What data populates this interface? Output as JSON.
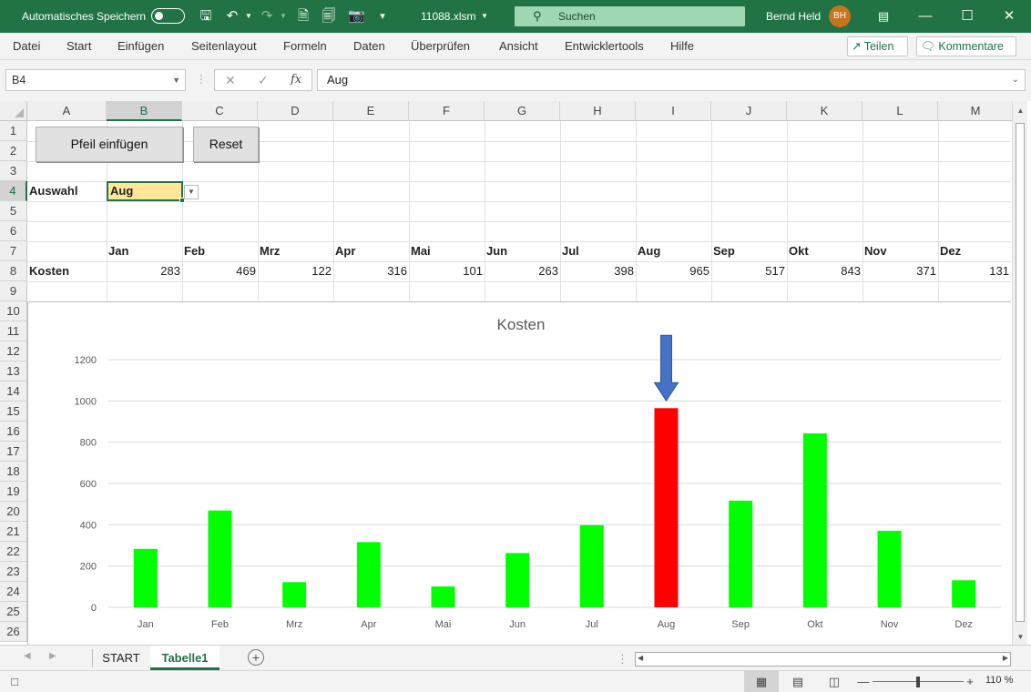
{
  "titlebar": {
    "autosave_label": "Automatisches Speichern",
    "filename": "11088.xlsm",
    "search_placeholder": "Suchen",
    "user_name": "Bernd Held",
    "user_initials": "BH"
  },
  "menu": {
    "items": [
      "Datei",
      "Start",
      "Einfügen",
      "Seitenlayout",
      "Formeln",
      "Daten",
      "Überprüfen",
      "Ansicht",
      "Entwicklertools",
      "Hilfe"
    ],
    "share_label": "Teilen",
    "comments_label": "Kommentare"
  },
  "formula_bar": {
    "name_box": "B4",
    "value": "Aug",
    "fx_label": "fx"
  },
  "columns": [
    "A",
    "B",
    "C",
    "D",
    "E",
    "F",
    "G",
    "H",
    "I",
    "J",
    "K",
    "L",
    "M"
  ],
  "selected_column": "B",
  "rows": [
    "1",
    "2",
    "3",
    "4",
    "5",
    "6",
    "7",
    "8",
    "9",
    "10",
    "11",
    "12",
    "13",
    "14",
    "15",
    "16",
    "17",
    "18",
    "19",
    "20",
    "21",
    "22",
    "23",
    "24",
    "25",
    "26"
  ],
  "selected_row": "4",
  "sheet": {
    "button_insert": "Pfeil einfügen",
    "button_reset": "Reset",
    "label_auswahl": "Auswahl",
    "selected_month": "Aug",
    "label_kosten": "Kosten",
    "months": [
      "Jan",
      "Feb",
      "Mrz",
      "Apr",
      "Mai",
      "Jun",
      "Jul",
      "Aug",
      "Sep",
      "Okt",
      "Nov",
      "Dez"
    ],
    "values": [
      "283",
      "469",
      "122",
      "316",
      "101",
      "263",
      "398",
      "965",
      "517",
      "843",
      "371",
      "131"
    ]
  },
  "chart_data": {
    "type": "bar",
    "title": "Kosten",
    "categories": [
      "Jan",
      "Feb",
      "Mrz",
      "Apr",
      "Mai",
      "Jun",
      "Jul",
      "Aug",
      "Sep",
      "Okt",
      "Nov",
      "Dez"
    ],
    "series": [
      {
        "values": [
          283,
          469,
          122,
          316,
          101,
          263,
          398,
          965,
          517,
          843,
          371,
          131
        ]
      }
    ],
    "highlight_category": "Aug",
    "bar_color": "#00ff00",
    "highlight_color": "#ff0000",
    "arrow_color": "#4472c4",
    "ylim": [
      0,
      1200
    ],
    "yticks": [
      0,
      200,
      400,
      600,
      800,
      1000,
      1200
    ],
    "grid": true,
    "xlabel": "",
    "ylabel": ""
  },
  "tabs": {
    "items": [
      "START",
      "Tabelle1"
    ],
    "active": "Tabelle1"
  },
  "status": {
    "zoom": "110 %"
  },
  "colors": {
    "accent": "#217346"
  }
}
